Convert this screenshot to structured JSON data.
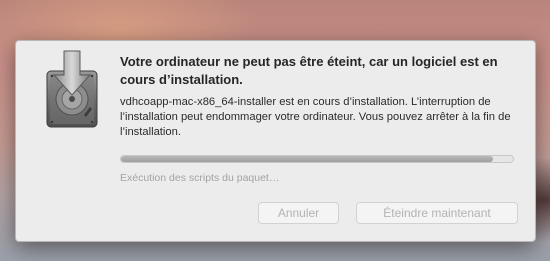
{
  "dialog": {
    "title": "Votre ordinateur ne peut pas être éteint, car un logiciel est en cours d’installation.",
    "message": "vdhcoapp-mac-x86_64-installer est en cours d’installation. L’interruption de l’installation peut endommager votre ordinateur. Vous pouvez arrêter à la fin de l’installation.",
    "progress_percent": 95,
    "status": "Exécution des scripts du paquet…",
    "buttons": {
      "cancel": "Annuler",
      "shutdown": "Éteindre maintenant"
    },
    "icon": "installer-package-icon"
  },
  "colors": {
    "dialog_bg": "#ececec",
    "disabled_text": "#b3b3b3",
    "progress_fill": "#a8a8a8"
  }
}
